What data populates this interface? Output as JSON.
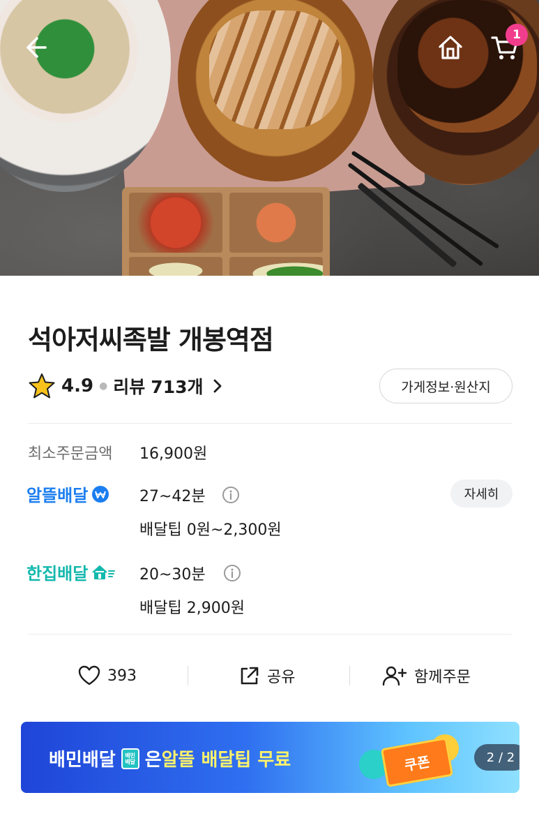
{
  "header": {
    "cart_count": "1"
  },
  "store": {
    "name": "석아저씨족발 개봉역점",
    "rating": "4.9",
    "review_label": "리뷰",
    "review_count": "713개",
    "info_button": "가게정보·원산지"
  },
  "order": {
    "min_order_label": "최소주문금액",
    "min_order_value": "16,900원"
  },
  "delivery": {
    "saver": {
      "brand": "알뜰배달",
      "time": "27~42분",
      "tip": "배달팁 0원~2,300원",
      "detail_button": "자세히"
    },
    "single": {
      "brand": "한집배달",
      "time": "20~30분",
      "tip": "배달팁 2,900원"
    }
  },
  "actions": {
    "like_count": "393",
    "share_label": "공유",
    "group_order_label": "함께주문"
  },
  "banner": {
    "brand": "배민배달",
    "text_a": "은 ",
    "text_highlight": "알뜰 배달팁 무료",
    "coupon_label": "쿠폰",
    "page": "2 / 2"
  },
  "colors": {
    "saver_blue": "#1b7ef0",
    "single_teal": "#14b8ad",
    "badge_pink": "#f23d8d",
    "star_yellow": "#f6c21b"
  },
  "icons": {
    "back": "arrow-left-icon",
    "home": "home-icon",
    "cart": "cart-icon",
    "star": "star-icon",
    "info": "info-circle-icon",
    "like": "heart-icon",
    "share": "share-icon",
    "group": "add-person-icon"
  }
}
